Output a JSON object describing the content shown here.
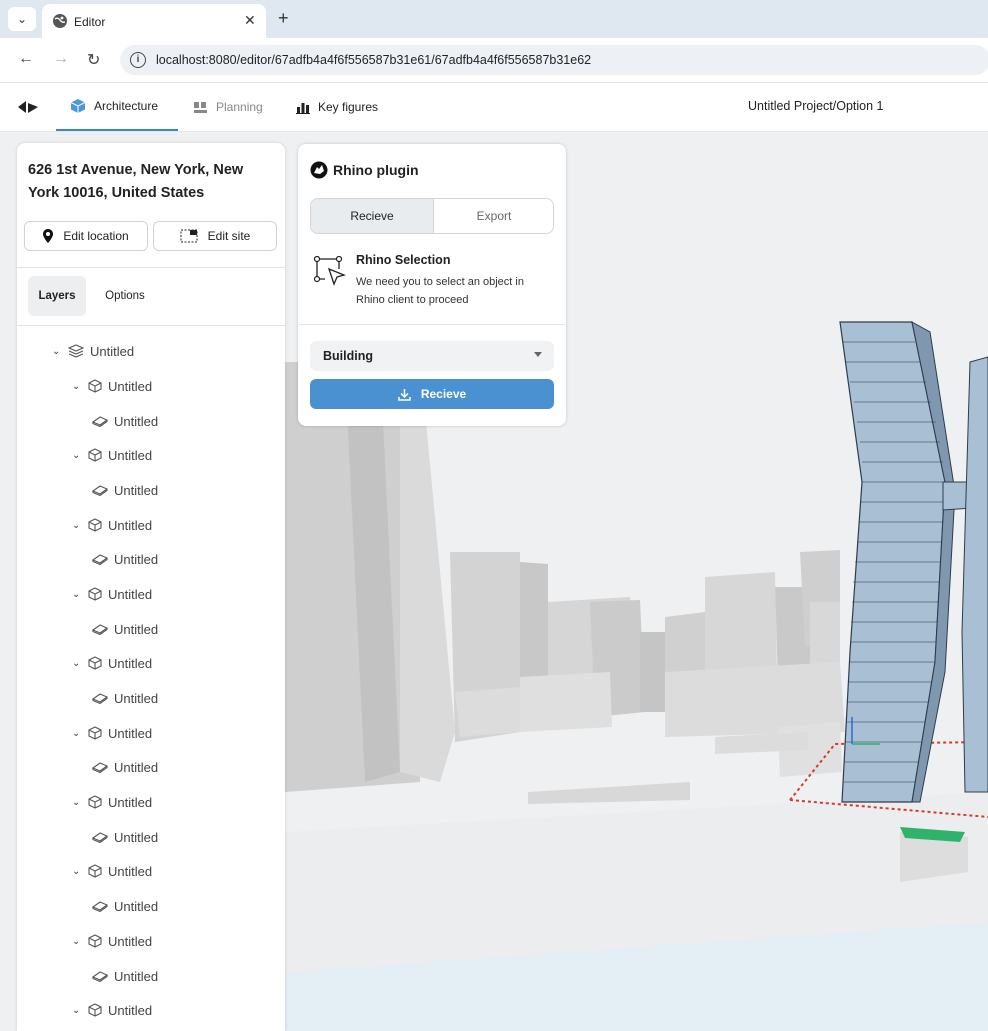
{
  "browser": {
    "tab_title": "Editor",
    "tab_close": "✕",
    "new_tab": "+",
    "url": "localhost:8080/editor/67adfb4a4f6f556587b31e61/67adfb4a4f6f556587b31e62"
  },
  "app": {
    "tabs": [
      {
        "label": "Architecture",
        "icon": "cube-icon"
      },
      {
        "label": "Planning",
        "icon": "planning-icon"
      },
      {
        "label": "Key figures",
        "icon": "bar-chart-icon"
      }
    ],
    "project_path": "Untitled Project/Option 1",
    "accent_color": "#3a86c8"
  },
  "left_panel": {
    "address": "626 1st Avenue, New York, New York 10016, United States",
    "edit_location": "Edit location",
    "edit_site": "Edit site",
    "segments": [
      "Layers",
      "Options"
    ],
    "tree": {
      "root": "Untitled",
      "groups": [
        {
          "label": "Untitled",
          "child": "Untitled"
        },
        {
          "label": "Untitled",
          "child": "Untitled"
        },
        {
          "label": "Untitled",
          "child": "Untitled"
        },
        {
          "label": "Untitled",
          "child": "Untitled"
        },
        {
          "label": "Untitled",
          "child": "Untitled"
        },
        {
          "label": "Untitled",
          "child": "Untitled"
        },
        {
          "label": "Untitled",
          "child": "Untitled"
        },
        {
          "label": "Untitled",
          "child": "Untitled"
        },
        {
          "label": "Untitled",
          "child": "Untitled"
        },
        {
          "label": "Untitled"
        }
      ]
    }
  },
  "rhino_panel": {
    "title": "Rhino plugin",
    "toggle": [
      "Recieve",
      "Export"
    ],
    "selection_title": "Rhino Selection",
    "selection_desc": "We need you to select an object in Rhino client to proceed",
    "dropdown_value": "Building",
    "action_label": "Recieve",
    "action_color": "#4a91d1"
  }
}
